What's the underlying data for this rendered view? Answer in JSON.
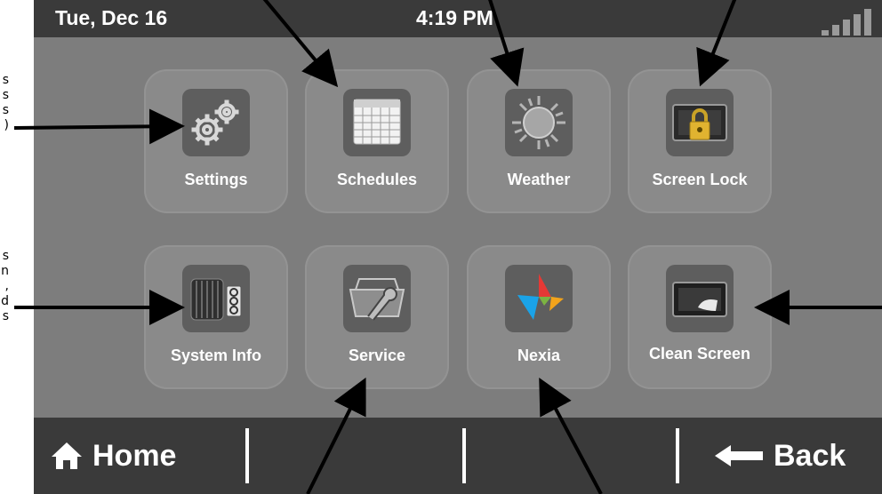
{
  "annotations": {
    "upper": [
      "s",
      "s",
      "s",
      ")"
    ],
    "lower": [
      "s",
      "n",
      ",",
      "d",
      "s"
    ]
  },
  "status_bar": {
    "date": "Tue, Dec 16",
    "time": "4:19 PM",
    "signal_icon": "signal-strength-icon"
  },
  "tiles": [
    {
      "label": "Settings",
      "icon": "gears-icon"
    },
    {
      "label": "Schedules",
      "icon": "calendar-icon"
    },
    {
      "label": "Weather",
      "icon": "sun-icon"
    },
    {
      "label": "Screen Lock",
      "icon": "padlock-icon"
    },
    {
      "label": "System Info",
      "icon": "ac-unit-icon"
    },
    {
      "label": "Service",
      "icon": "toolbox-wrench-icon"
    },
    {
      "label": "Nexia",
      "icon": "nexia-logo-icon"
    },
    {
      "label": "Clean Screen",
      "icon": "cleaning-screen-icon"
    }
  ],
  "bottom_bar": {
    "home_label": "Home",
    "home_icon": "house-icon",
    "back_label": "Back",
    "back_icon": "left-arrow-icon"
  },
  "colors": {
    "screen_bg": "#7d7d7d",
    "bar_bg": "#3a3a3a",
    "tile_bg": "#8a8a8a",
    "icon_box_bg": "#5e5e5e"
  }
}
